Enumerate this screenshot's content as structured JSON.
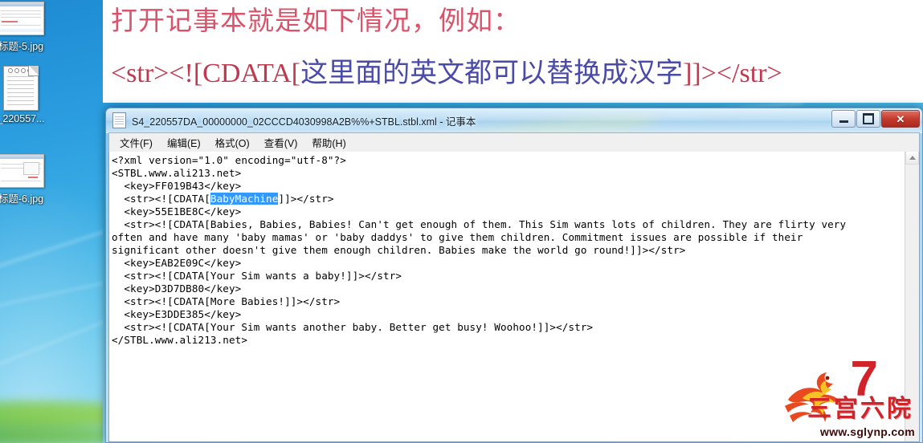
{
  "document": {
    "heading_line1": "打开记事本就是如下情况，例如：",
    "heading_line2": {
      "prefix": "<str><![CDATA[",
      "cjk": "这里面的英文都可以替换成汉字",
      "suffix": "]]></str>"
    },
    "colors": {
      "heading_red": "#d9546b",
      "tag_red": "#c0394f",
      "cjk_blue": "#4a4aa8"
    }
  },
  "desktop": {
    "wallpaper_color": "#2b9ee0",
    "icons": [
      {
        "label": "标题-5.jpg",
        "type": "image-file-icon"
      },
      {
        "label": "_220557...",
        "type": "text-file-icon"
      },
      {
        "label": "标题-6.jpg",
        "type": "image-file-icon"
      }
    ]
  },
  "notepad": {
    "title": "S4_220557DA_00000000_02CCCD4030998A2B%%+STBL.stbl.xml - 记事本",
    "menu": [
      {
        "label": "文件(F)"
      },
      {
        "label": "编辑(E)"
      },
      {
        "label": "格式(O)"
      },
      {
        "label": "查看(V)"
      },
      {
        "label": "帮助(H)"
      }
    ],
    "window_buttons": {
      "minimize": "最小化",
      "maximize": "最大化",
      "close": "关闭"
    },
    "selection": {
      "text": "BabyMachine",
      "highlight_color": "#3399ff",
      "text_color": "#ffffff"
    },
    "content": {
      "line1": "<?xml version=\"1.0\" encoding=\"utf-8\"?>",
      "line2": "<STBL.www.ali213.net>",
      "line3": "  <key>FF019B43</key>",
      "line4_before": "  <str><![CDATA[",
      "line4_after": "]]></str>",
      "line5": "  <key>55E1BE8C</key>",
      "line6": "  <str><![CDATA[Babies, Babies, Babies! Can't get enough of them. This Sim wants lots of children. They are flirty very",
      "line7": "often and have many 'baby mamas' or 'baby daddys' to give them children. Commitment issues are possible if their",
      "line8": "significant other doesn't give them enough children. Babies make the world go round!]]></str>",
      "line9": "  <key>EAB2E09C</key>",
      "line10": "  <str><![CDATA[Your Sim wants a baby!]]></str>",
      "line11": "  <key>D3D7DB80</key>",
      "line12": "  <str><![CDATA[More Babies!]]></str>",
      "line13": "  <key>E3DDE385</key>",
      "line14": "  <str><![CDATA[Your Sim wants another baby. Better get busy! Woohoo!]]></str>",
      "line15": "</STBL.www.ali213.net>"
    }
  },
  "watermark": {
    "number": "7",
    "name": "三宫六院",
    "url": "www.sglynp.com",
    "color": "#d2232a"
  }
}
